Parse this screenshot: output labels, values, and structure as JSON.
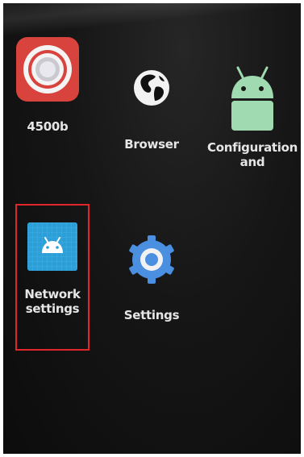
{
  "apps": [
    {
      "label": "4500b",
      "icon": "camera-lens-icon",
      "color": "#d8443d"
    },
    {
      "label": "Browser",
      "icon": "globe-icon",
      "color": "#ffffff"
    },
    {
      "label": "Configuration\nand",
      "icon": "android-robot-icon",
      "color": "#a0dab0"
    },
    {
      "label": "Network\nsettings",
      "icon": "android-tile-icon",
      "color": "#2a9fd8"
    },
    {
      "label": "Settings",
      "icon": "gear-icon",
      "color": "#4a8fe0"
    }
  ],
  "highlight_color": "#e0262b"
}
